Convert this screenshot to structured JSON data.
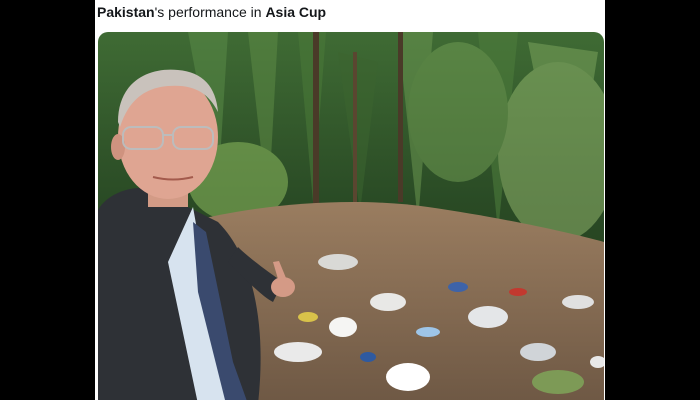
{
  "tweet": {
    "caption_part1": "Pakistan",
    "caption_part2": "'s performance in ",
    "caption_part3": "Asia Cup"
  },
  "photo": {
    "subject": "man-in-suit-pointing-at-litter",
    "colors": {
      "foliage": "#2f5a2a",
      "ground": "#8a6f55",
      "suit": "#2e3136",
      "shirt": "#d7e3ef",
      "tie": "#3a4a6e"
    }
  }
}
